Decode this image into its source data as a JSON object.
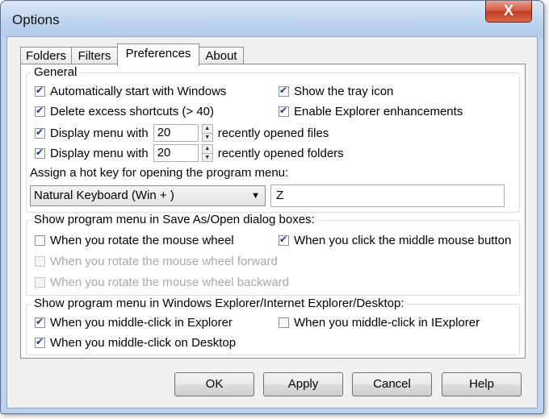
{
  "window": {
    "title": "Options",
    "close_label": "X"
  },
  "tabs": [
    {
      "label": "Folders",
      "active": false
    },
    {
      "label": "Filters",
      "active": false
    },
    {
      "label": "Preferences",
      "active": true
    },
    {
      "label": "About",
      "active": false
    }
  ],
  "general": {
    "legend": "General",
    "auto_start": "Automatically start with Windows",
    "tray_icon": "Show the tray icon",
    "delete_shortcuts": "Delete excess shortcuts (> 40)",
    "explorer_enh": "Enable Explorer enhancements",
    "display_menu_with": "Display menu with",
    "files_count": "20",
    "recent_files": "recently opened files",
    "folders_count": "20",
    "recent_folders": "recently opened folders",
    "hotkey_label": "Assign a hot key for opening the program menu:",
    "hotkey_modifier": "Natural Keyboard (Win + )",
    "hotkey_key": "Z"
  },
  "saveas": {
    "legend": "Show program menu in Save As/Open dialog boxes:",
    "rotate_wheel": "When you rotate the mouse wheel",
    "middle_click": "When you click the middle mouse button",
    "rotate_forward": "When you rotate the mouse wheel forward",
    "rotate_backward": "When you rotate the mouse wheel backward"
  },
  "explorer": {
    "legend": "Show program menu in Windows Explorer/Internet Explorer/Desktop:",
    "middle_explorer": "When you middle-click in Explorer",
    "middle_iexplorer": "When you middle-click in IExplorer",
    "middle_desktop": "When you middle-click on Desktop"
  },
  "buttons": {
    "ok": "OK",
    "apply": "Apply",
    "cancel": "Cancel",
    "help": "Help"
  }
}
